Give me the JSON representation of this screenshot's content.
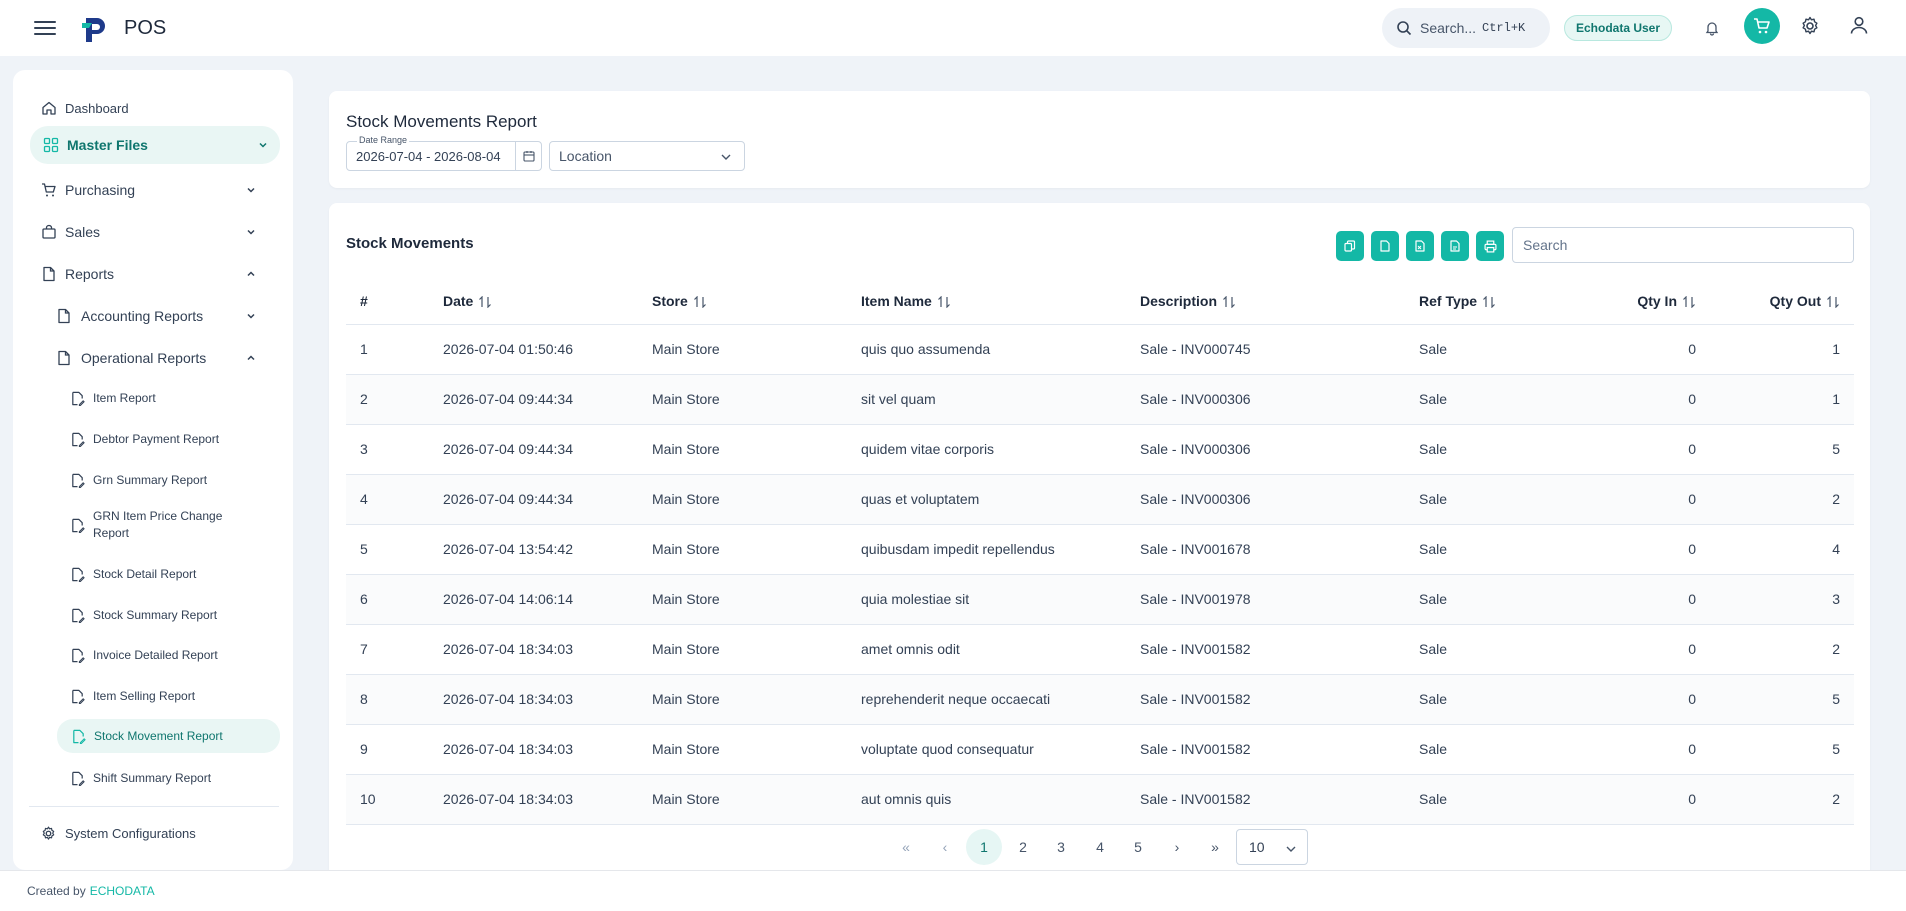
{
  "header": {
    "app_name": "POS",
    "search_placeholder": "Search...",
    "search_shortcut": "Ctrl+K",
    "user": "Echodata User"
  },
  "sidebar": {
    "dashboard": "Dashboard",
    "master_files": "Master Files",
    "purchasing": "Purchasing",
    "sales": "Sales",
    "reports": "Reports",
    "accounting_reports": "Accounting Reports",
    "operational_reports": "Operational Reports",
    "operational_items": [
      "Item Report",
      "Debtor Payment Report",
      "Grn Summary Report",
      "GRN Item Price Change Report",
      "Stock Detail Report",
      "Stock Summary Report",
      "Invoice Detailed Report",
      "Item Selling Report",
      "Stock Movement Report",
      "Shift Summary Report"
    ],
    "system_configurations": "System Configurations"
  },
  "filters": {
    "title": "Stock Movements Report",
    "date_range_label": "Date Range",
    "date_range_value": "2026-07-04 - 2026-08-04",
    "location_placeholder": "Location"
  },
  "table": {
    "title": "Stock Movements",
    "search_placeholder": "Search",
    "columns": [
      "#",
      "Date",
      "Store",
      "Item Name",
      "Description",
      "Ref Type",
      "Qty In",
      "Qty Out"
    ],
    "rows": [
      [
        "1",
        "2026-07-04 01:50:46",
        "Main Store",
        "quis quo assumenda",
        "Sale - INV000745",
        "Sale",
        "0",
        "1"
      ],
      [
        "2",
        "2026-07-04 09:44:34",
        "Main Store",
        "sit vel quam",
        "Sale - INV000306",
        "Sale",
        "0",
        "1"
      ],
      [
        "3",
        "2026-07-04 09:44:34",
        "Main Store",
        "quidem vitae corporis",
        "Sale - INV000306",
        "Sale",
        "0",
        "5"
      ],
      [
        "4",
        "2026-07-04 09:44:34",
        "Main Store",
        "quas et voluptatem",
        "Sale - INV000306",
        "Sale",
        "0",
        "2"
      ],
      [
        "5",
        "2026-07-04 13:54:42",
        "Main Store",
        "quibusdam impedit repellendus",
        "Sale - INV001678",
        "Sale",
        "0",
        "4"
      ],
      [
        "6",
        "2026-07-04 14:06:14",
        "Main Store",
        "quia molestiae sit",
        "Sale - INV001978",
        "Sale",
        "0",
        "3"
      ],
      [
        "7",
        "2026-07-04 18:34:03",
        "Main Store",
        "amet omnis odit",
        "Sale - INV001582",
        "Sale",
        "0",
        "2"
      ],
      [
        "8",
        "2026-07-04 18:34:03",
        "Main Store",
        "reprehenderit neque occaecati",
        "Sale - INV001582",
        "Sale",
        "0",
        "5"
      ],
      [
        "9",
        "2026-07-04 18:34:03",
        "Main Store",
        "voluptate quod consequatur",
        "Sale - INV001582",
        "Sale",
        "0",
        "5"
      ],
      [
        "10",
        "2026-07-04 18:34:03",
        "Main Store",
        "aut omnis quis",
        "Sale - INV001582",
        "Sale",
        "0",
        "2"
      ]
    ]
  },
  "pagination": {
    "first": "«",
    "prev": "‹",
    "pages": [
      "1",
      "2",
      "3",
      "4",
      "5"
    ],
    "current_page": "1",
    "next": "›",
    "last": "»",
    "rows_per_page": "10"
  },
  "footer": {
    "created_by": "Created by",
    "brand": "ECHODATA"
  },
  "colors": {
    "accent": "#14b8a6",
    "accent_text": "#0f766e",
    "active_bg": "#e9f6f4",
    "page_bg": "#eff3f8"
  }
}
